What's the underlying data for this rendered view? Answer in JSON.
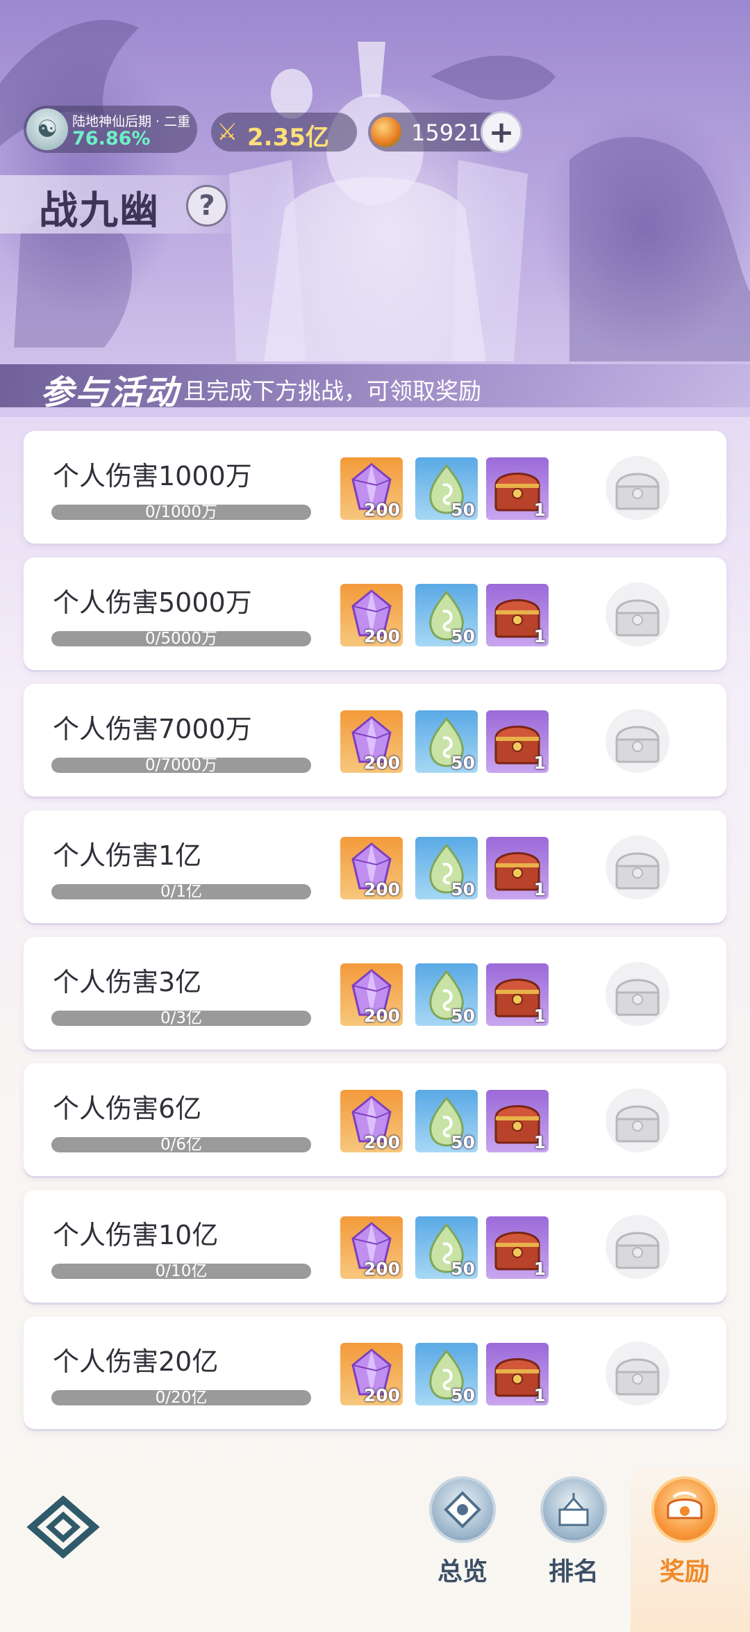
{
  "header": {
    "realm_name": "陆地神仙后期 · 二重",
    "realm_progress": "76.86%",
    "power": "2.35亿",
    "currency": "15921",
    "add_label": "+",
    "title": "战九幽",
    "help_label": "?"
  },
  "notice": {
    "main": "参与活动",
    "sub": "且完成下方挑战，可领取奖励"
  },
  "tasks": [
    {
      "title": "个人伤害1000万",
      "progress_text": "0/1000万",
      "progress": 0,
      "rewards": [
        "200",
        "50",
        "1"
      ]
    },
    {
      "title": "个人伤害5000万",
      "progress_text": "0/5000万",
      "progress": 0,
      "rewards": [
        "200",
        "50",
        "1"
      ]
    },
    {
      "title": "个人伤害7000万",
      "progress_text": "0/7000万",
      "progress": 0,
      "rewards": [
        "200",
        "50",
        "1"
      ]
    },
    {
      "title": "个人伤害1亿",
      "progress_text": "0/1亿",
      "progress": 0,
      "rewards": [
        "200",
        "50",
        "1"
      ]
    },
    {
      "title": "个人伤害3亿",
      "progress_text": "0/3亿",
      "progress": 0,
      "rewards": [
        "200",
        "50",
        "1"
      ]
    },
    {
      "title": "个人伤害6亿",
      "progress_text": "0/6亿",
      "progress": 0,
      "rewards": [
        "200",
        "50",
        "1"
      ]
    },
    {
      "title": "个人伤害10亿",
      "progress_text": "0/10亿",
      "progress": 0,
      "rewards": [
        "200",
        "50",
        "1"
      ]
    },
    {
      "title": "个人伤害20亿",
      "progress_text": "0/20亿",
      "progress": 0,
      "rewards": [
        "200",
        "50",
        "1"
      ]
    }
  ],
  "reward_icons": [
    "crystal-icon",
    "jade-drop-icon",
    "treasure-chest-icon"
  ],
  "nav": {
    "overview": "总览",
    "ranking": "排名",
    "rewards": "奖励"
  },
  "colors": {
    "accent_active": "#f08a2a",
    "realm_progress": "#6ff0c8",
    "power": "#ffe07a"
  }
}
